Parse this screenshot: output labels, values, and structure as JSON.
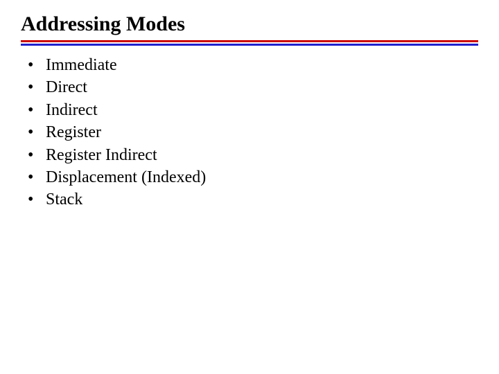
{
  "title": "Addressing Modes",
  "items": [
    "Immediate",
    "Direct",
    "Indirect",
    "Register",
    "Register Indirect",
    "Displacement (Indexed)",
    "Stack"
  ]
}
